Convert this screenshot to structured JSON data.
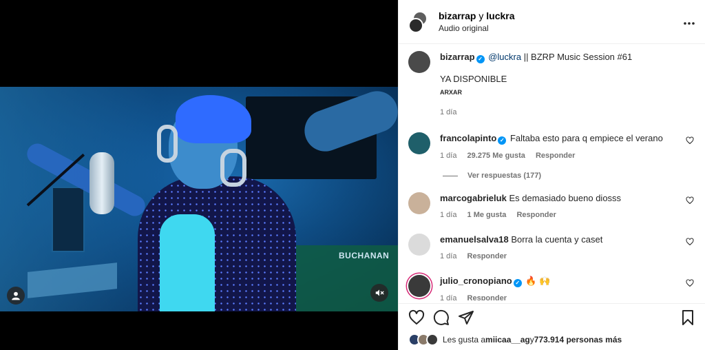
{
  "header": {
    "user1": "bizarrap",
    "joiner": "y",
    "user2": "luckra",
    "subtitle": "Audio original",
    "more_icon": "more-horizontal-icon"
  },
  "video": {
    "overlay_text": "BUCHANAN",
    "user_tag_icon": "user-icon",
    "mute_icon": "speaker-muted-icon"
  },
  "caption": {
    "username": "bizarrap",
    "mention": "@luckra",
    "text": " || BZRP Music Session #61",
    "line2": "YA DISPONIBLE",
    "line3": "ARXAR",
    "time": "1 día"
  },
  "comments": [
    {
      "username": "francolapinto",
      "verified": true,
      "text": "Faltaba esto para q empiece el verano",
      "time": "1 día",
      "likes": "29.275 Me gusta",
      "reply": "Responder",
      "avatar_color": "#1f5f6a"
    },
    {
      "username": "marcogabrieluk",
      "verified": false,
      "text": "Es demasiado bueno diosss",
      "time": "1 día",
      "likes": "1 Me gusta",
      "reply": "Responder",
      "avatar_color": "#c9b19a"
    },
    {
      "username": "emanuelsalva18",
      "verified": false,
      "text": "Borra la cuenta y caset",
      "time": "1 día",
      "likes": "",
      "reply": "Responder",
      "avatar_color": "#dbdbdb"
    },
    {
      "username": "julio_cronopiano",
      "verified": true,
      "text": "🔥 🙌",
      "time": "1 día",
      "likes": "",
      "reply": "Responder",
      "avatar_color": "#3a3a3a"
    }
  ],
  "view_replies": "Ver respuestas (177)",
  "actions": {
    "like_icon": "heart-icon",
    "comment_icon": "comment-icon",
    "share_icon": "share-icon",
    "save_icon": "bookmark-icon"
  },
  "likes": {
    "prefix": "Les gusta a ",
    "user": "miicaa__ag",
    "middle": " y ",
    "count": "773.914 personas más"
  },
  "colors": {
    "verified": "#0095f6",
    "mention": "#00376b",
    "muted_text": "#737373"
  }
}
